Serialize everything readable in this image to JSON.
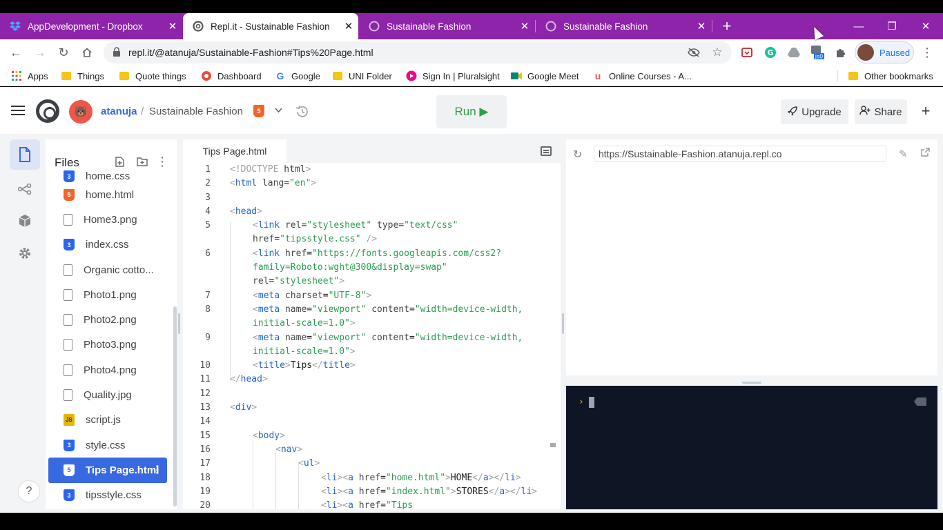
{
  "browser": {
    "tabs": [
      {
        "title": "AppDevelopment - Dropbox",
        "close": "✕",
        "icon": "dropbox-icon"
      },
      {
        "title": "Repl.it - Sustainable Fashion",
        "close": "✕",
        "icon": "replit-icon",
        "active": true
      },
      {
        "title": "Sustainable Fashion",
        "close": "✕",
        "icon": "globe-icon"
      },
      {
        "title": "Sustainable Fashion",
        "close": "✕",
        "icon": "globe-icon"
      }
    ],
    "new_tab": "+",
    "window_controls": {
      "minimize": "—",
      "restore": "❐",
      "close": "✕"
    },
    "url": "repl.it/@atanuja/Sustainable-Fashion#Tips%20Page.html",
    "profile_label": "Paused",
    "extension_badge": "js0",
    "bookmarks": [
      {
        "label": "Apps",
        "icon": "apps-grid-icon"
      },
      {
        "label": "Things",
        "icon": "folder-icon"
      },
      {
        "label": "Quote things",
        "icon": "folder-icon"
      },
      {
        "label": "Dashboard",
        "icon": "dashboard-icon"
      },
      {
        "label": "Google",
        "icon": "google-icon"
      },
      {
        "label": "UNI Folder",
        "icon": "folder-icon"
      },
      {
        "label": "Sign In | Pluralsight",
        "icon": "pluralsight-icon"
      },
      {
        "label": "Google Meet",
        "icon": "meet-icon"
      },
      {
        "label": "Online Courses - A...",
        "icon": "udemy-icon"
      }
    ],
    "other_bookmarks": "Other bookmarks"
  },
  "repl": {
    "username": "atanuja",
    "separator": "/",
    "name": "Sustainable Fashion",
    "language_badge": "5",
    "run_label": "Run ▶",
    "upgrade_label": "Upgrade",
    "share_label": "Share",
    "plus_label": "+"
  },
  "sidebar": {
    "title": "Files",
    "help": "?",
    "files": [
      {
        "name": "home.css",
        "type": "css"
      },
      {
        "name": "home.html",
        "type": "html"
      },
      {
        "name": "Home3.png",
        "type": "doc"
      },
      {
        "name": "index.css",
        "type": "css"
      },
      {
        "name": "Organic cotto...",
        "type": "doc"
      },
      {
        "name": "Photo1.png",
        "type": "doc"
      },
      {
        "name": "Photo2.png",
        "type": "doc"
      },
      {
        "name": "Photo3.png",
        "type": "doc"
      },
      {
        "name": "Photo4.png",
        "type": "doc"
      },
      {
        "name": "Quality.jpg",
        "type": "doc"
      },
      {
        "name": "script.js",
        "type": "js"
      },
      {
        "name": "style.css",
        "type": "css"
      },
      {
        "name": "Tips Page.html",
        "type": "html",
        "active": true
      },
      {
        "name": "tipsstyle.css",
        "type": "css"
      }
    ]
  },
  "editor": {
    "tab_title": "Tips Page.html",
    "lines": [
      {
        "n": "1",
        "indent": 0,
        "html": "<span class='k'>&lt;!DOCTYPE</span> <span class='at'>html</span><span class='k'>&gt;</span>"
      },
      {
        "n": "2",
        "indent": 0,
        "html": "<span class='k'>&lt;</span><span class='tg'>html</span> <span class='at'>lang</span>=<span class='st'>\"en\"</span><span class='k'>&gt;</span>"
      },
      {
        "n": "3",
        "indent": 0,
        "html": ""
      },
      {
        "n": "4",
        "indent": 0,
        "html": "<span class='k'>&lt;</span><span class='tg'>head</span><span class='k'>&gt;</span>"
      },
      {
        "n": "5",
        "indent": 1,
        "html": "<span class='k'>&lt;</span><span class='tg'>link</span> <span class='at'>rel</span>=<span class='st'>\"stylesheet\"</span> <span class='at'>type</span>=<span class='st'>\"text/css\"</span>"
      },
      {
        "n": "",
        "indent": 1,
        "html": "<span class='at'>href</span>=<span class='st'>\"tipsstyle.css\"</span> <span class='k'>/&gt;</span>"
      },
      {
        "n": "6",
        "indent": 1,
        "html": "<span class='k'>&lt;</span><span class='tg'>link</span> <span class='at'>href</span>=<span class='st'>\"https://fonts.googleapis.com/css2?</span>"
      },
      {
        "n": "",
        "indent": 1,
        "html": "<span class='st'>family=Roboto:wght@300&amp;display=swap\"</span>"
      },
      {
        "n": "",
        "indent": 1,
        "html": "<span class='at'>rel</span>=<span class='st'>\"stylesheet\"</span><span class='k'>&gt;</span>"
      },
      {
        "n": "7",
        "indent": 1,
        "html": "<span class='k'>&lt;</span><span class='tg'>meta</span> <span class='at'>charset</span>=<span class='st'>\"UTF-8\"</span><span class='k'>&gt;</span>"
      },
      {
        "n": "8",
        "indent": 1,
        "html": "<span class='k'>&lt;</span><span class='tg'>meta</span> <span class='at'>name</span>=<span class='st'>\"viewport\"</span> <span class='at'>content</span>=<span class='st'>\"width=device-width,</span>"
      },
      {
        "n": "",
        "indent": 1,
        "html": "<span class='st'>initial-scale=1.0\"</span><span class='k'>&gt;</span>"
      },
      {
        "n": "9",
        "indent": 1,
        "html": "<span class='k'>&lt;</span><span class='tg'>meta</span> <span class='at'>name</span>=<span class='st'>\"viewport\"</span> <span class='at'>content</span>=<span class='st'>\"width=device-width,</span>"
      },
      {
        "n": "",
        "indent": 1,
        "html": "<span class='st'>initial-scale=1.0\"</span><span class='k'>&gt;</span>"
      },
      {
        "n": "10",
        "indent": 1,
        "html": "<span class='k'>&lt;</span><span class='tg'>title</span><span class='k'>&gt;</span>Tips<span class='k'>&lt;/</span><span class='tg'>title</span><span class='k'>&gt;</span>"
      },
      {
        "n": "11",
        "indent": 0,
        "html": "<span class='k'>&lt;/</span><span class='tg'>head</span><span class='k'>&gt;</span>"
      },
      {
        "n": "12",
        "indent": 0,
        "html": ""
      },
      {
        "n": "13",
        "indent": 0,
        "html": "<span class='k'>&lt;</span><span class='tg'>div</span><span class='k'>&gt;</span>"
      },
      {
        "n": "14",
        "indent": 0,
        "html": ""
      },
      {
        "n": "15",
        "indent": 1,
        "html": "<span class='k'>&lt;</span><span class='tg'>body</span><span class='k'>&gt;</span>"
      },
      {
        "n": "16",
        "indent": 2,
        "html": "<span class='k'>&lt;</span><span class='tg'>nav</span><span class='k'>&gt;</span>"
      },
      {
        "n": "17",
        "indent": 3,
        "html": "<span class='k'>&lt;</span><span class='tg'>ul</span><span class='k'>&gt;</span>"
      },
      {
        "n": "18",
        "indent": 4,
        "html": "<span class='k'>&lt;</span><span class='tg'>li</span><span class='k'>&gt;&lt;</span><span class='tg'>a</span> <span class='at'>href</span>=<span class='st'>\"home.html\"</span><span class='k'>&gt;</span>HOME<span class='k'>&lt;/</span><span class='tg'>a</span><span class='k'>&gt;&lt;/</span><span class='tg'>li</span><span class='k'>&gt;</span>"
      },
      {
        "n": "19",
        "indent": 4,
        "html": "<span class='k'>&lt;</span><span class='tg'>li</span><span class='k'>&gt;&lt;</span><span class='tg'>a</span> <span class='at'>href</span>=<span class='st'>\"index.html\"</span><span class='k'>&gt;</span>STORES<span class='k'>&lt;/</span><span class='tg'>a</span><span class='k'>&gt;&lt;/</span><span class='tg'>li</span><span class='k'>&gt;</span>"
      },
      {
        "n": "20",
        "indent": 4,
        "html": "<span class='k'>&lt;</span><span class='tg'>li</span><span class='k'>&gt;&lt;</span><span class='tg'>a</span> <span class='at'>href</span>=<span class='st'>\"Tips</span>"
      }
    ]
  },
  "preview": {
    "url": "https://Sustainable-Fashion.atanuja.repl.co"
  },
  "console": {
    "prompt": "›"
  }
}
